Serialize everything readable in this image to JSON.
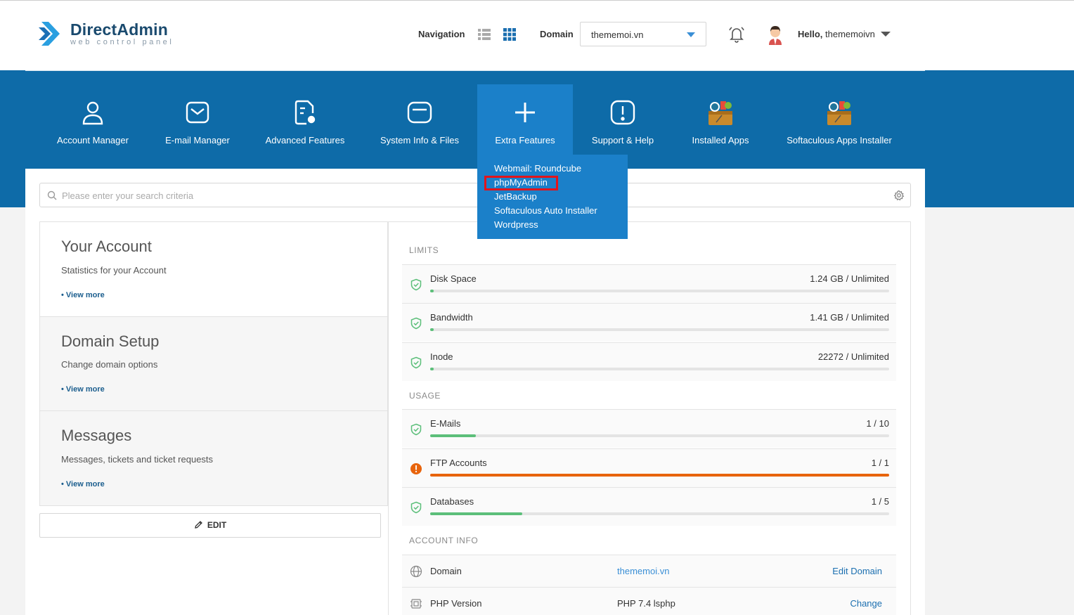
{
  "header": {
    "brand": "DirectAdmin",
    "brand_sub": "web control panel",
    "nav_label": "Navigation",
    "domain_label": "Domain",
    "domain_value": "thememoi.vn",
    "hello_prefix": "Hello,",
    "hello_user": "thememoivn"
  },
  "mainnav": [
    {
      "label": "Account Manager",
      "icon": "user-icon"
    },
    {
      "label": "E-mail Manager",
      "icon": "envelope-icon"
    },
    {
      "label": "Advanced Features",
      "icon": "document-gear-icon"
    },
    {
      "label": "System Info & Files",
      "icon": "folder-icon"
    },
    {
      "label": "Extra Features",
      "icon": "plus-icon"
    },
    {
      "label": "Support & Help",
      "icon": "alert-icon"
    },
    {
      "label": "Installed Apps",
      "icon": "apps-box-icon"
    },
    {
      "label": "Softaculous Apps Installer",
      "icon": "apps-box-icon"
    }
  ],
  "dropdown": [
    "Webmail: Roundcube",
    "phpMyAdmin",
    "JetBackup",
    "Softaculous Auto Installer",
    "Wordpress"
  ],
  "search": {
    "placeholder": "Please enter your search criteria"
  },
  "cards": [
    {
      "title": "Your Account",
      "desc": "Statistics for your Account",
      "more": "• View more"
    },
    {
      "title": "Domain Setup",
      "desc": "Change domain options",
      "more": "• View more"
    },
    {
      "title": "Messages",
      "desc": "Messages, tickets and ticket requests",
      "more": "• View more"
    }
  ],
  "edit_label": "EDIT",
  "sections": {
    "limits": "LIMITS",
    "usage": "USAGE",
    "account_info": "ACCOUNT INFO"
  },
  "limits": [
    {
      "name": "Disk Space",
      "amount": "1.24 GB / Unlimited",
      "fraction": 0.008,
      "status": "ok"
    },
    {
      "name": "Bandwidth",
      "amount": "1.41 GB / Unlimited",
      "fraction": 0.008,
      "status": "ok"
    },
    {
      "name": "Inode",
      "amount": "22272 / Unlimited",
      "fraction": 0.008,
      "status": "ok"
    }
  ],
  "usage": [
    {
      "name": "E-Mails",
      "amount": "1 / 10",
      "fraction": 0.1,
      "status": "ok"
    },
    {
      "name": "FTP Accounts",
      "amount": "1 / 1",
      "fraction": 1.0,
      "status": "warn"
    },
    {
      "name": "Databases",
      "amount": "1 / 5",
      "fraction": 0.2,
      "status": "ok"
    }
  ],
  "account_info": [
    {
      "name": "Domain",
      "value": "thememoi.vn",
      "action": "Edit Domain",
      "icon": "globe-icon"
    },
    {
      "name": "PHP Version",
      "value": "PHP 7.4 lsphp",
      "action": "Change",
      "icon": "chip-icon"
    }
  ],
  "colors": {
    "brand_blue": "#0e6ba8",
    "active_blue": "#1b80c9",
    "ok_green": "#5cbf7a",
    "warn_orange": "#e8640c",
    "highlight_red": "#e2141b"
  }
}
